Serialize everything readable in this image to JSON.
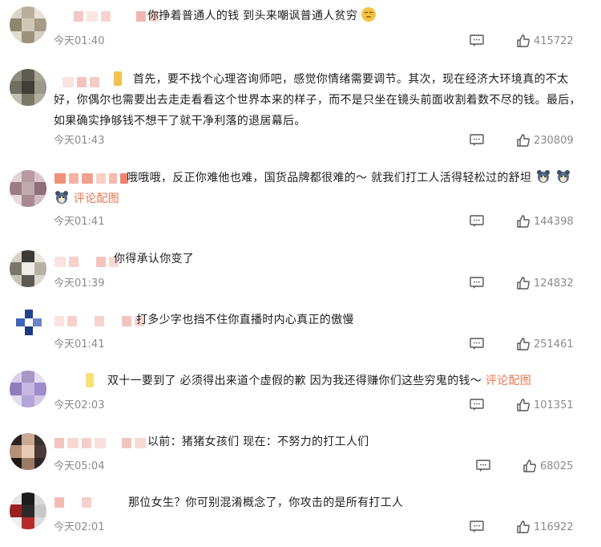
{
  "comments": [
    {
      "text_lines": [
        "你挣着普通人的钱 到头来嘲讽普通人贫穷"
      ],
      "emoji": "smirk-face-emoji",
      "time": "今天01:40",
      "likes": "415722"
    },
    {
      "text_lines": [
        "首先，要不找个心理咨询师吧，感觉你情绪需要调节。其次，现在经济大环境真的不太",
        "好，你偶尔也需要出去走走看看这个世界本来的样子，而不是只坐在镜头前面收割着数不尽的钱。最后，",
        "如果确实挣够钱不想干了就干净利落的退居幕后。"
      ],
      "time": "今天01:43",
      "likes": "230809"
    },
    {
      "text_lines": [
        "哦哦哦，反正你难他也难，国货品牌都很难的～ 就我们打工人活得轻松过的舒坦"
      ],
      "link": "评论配图",
      "time": "今天01:41",
      "likes": "144398"
    },
    {
      "text_lines": [
        "你得承认你变了"
      ],
      "time": "今天01:39",
      "likes": "124832"
    },
    {
      "text_lines": [
        "打多少字也挡不住你直播时内心真正的傲慢"
      ],
      "time": "今天01:41",
      "likes": "251461"
    },
    {
      "text_lines": [
        "双十一要到了 必须得出来道个虚假的歉 因为我还得赚你们这些穷鬼的钱～ "
      ],
      "link": "评论配图",
      "time": "今天02:03",
      "likes": "101351"
    },
    {
      "text_lines": [
        "以前：猪猪女孩们 现在：不努力的打工人们"
      ],
      "time": "今天05:04",
      "likes": "68025"
    },
    {
      "text_lines": [
        "那位女生？你可别混淆概念了，你攻击的是所有打工人"
      ],
      "time": "今天02:01",
      "likes": "116922"
    }
  ],
  "colors": {
    "link": "#e8744f",
    "meta": "#8a8a8a",
    "text": "#1f1f1f",
    "badge_gold": "#f2c14e",
    "badge_yellow": "#f7e27a"
  }
}
